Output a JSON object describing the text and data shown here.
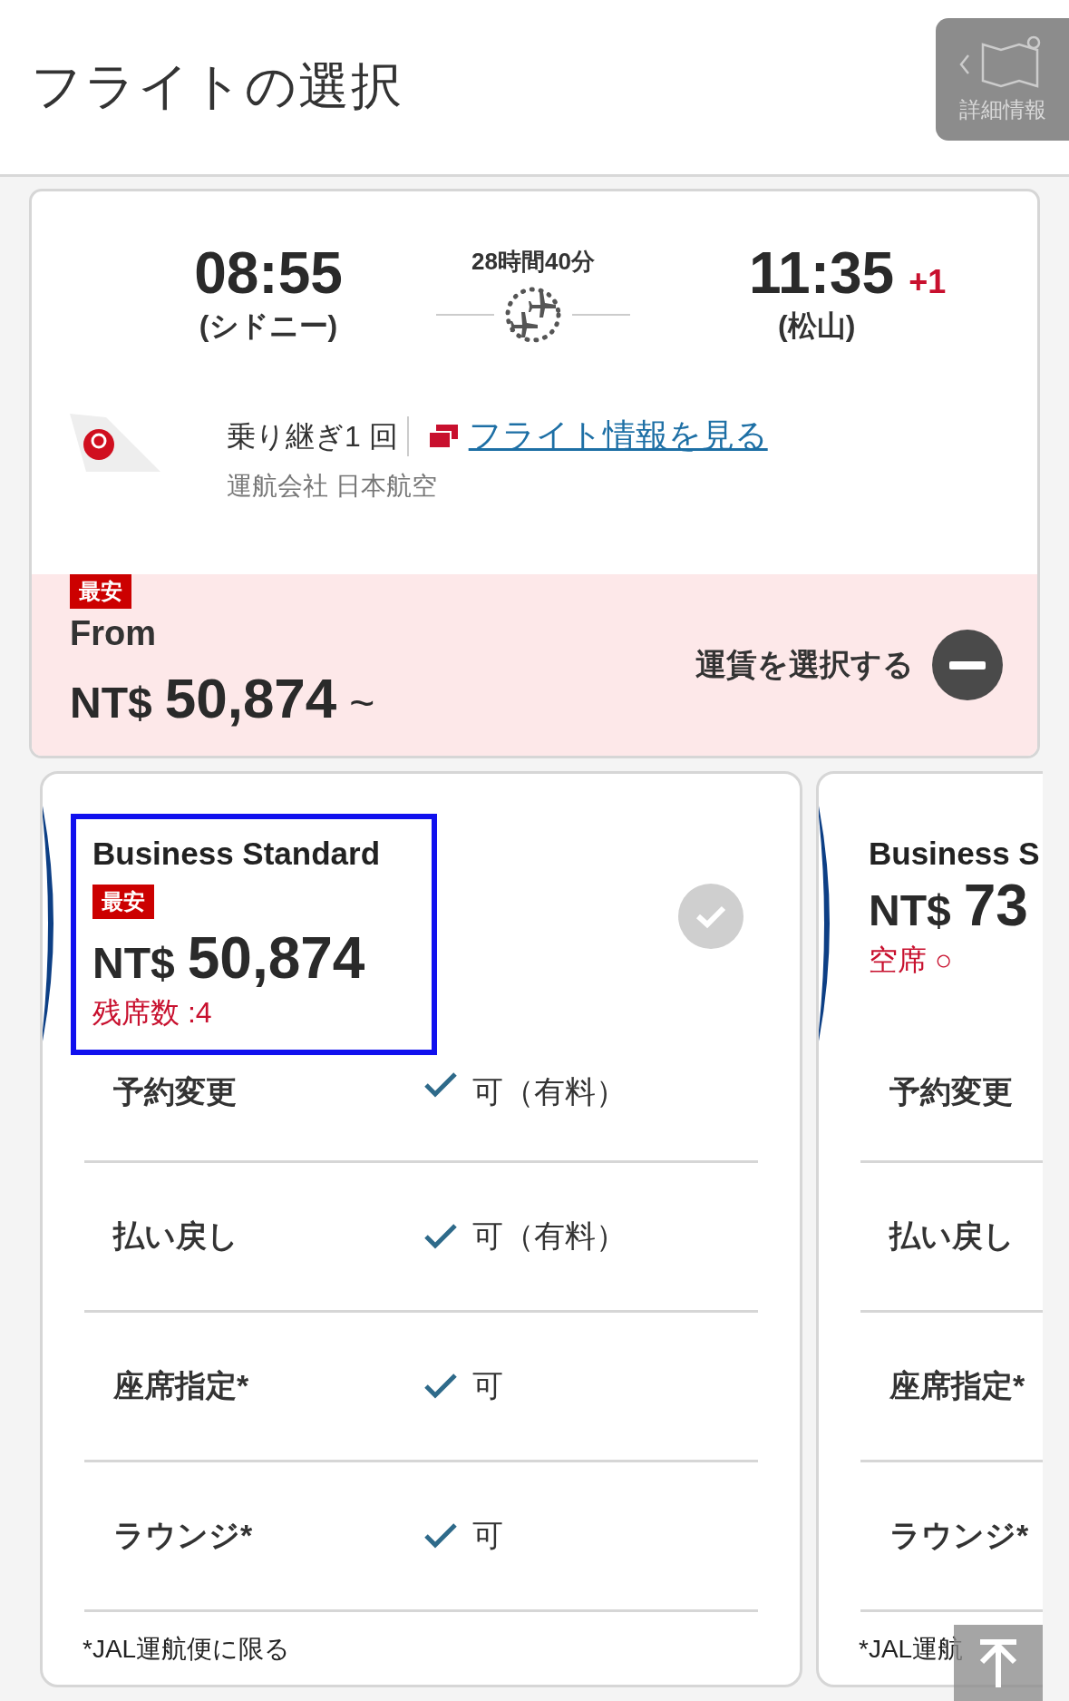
{
  "header": {
    "title": "フライトの選択",
    "detail_button": "詳細情報"
  },
  "flight": {
    "depart": {
      "time": "08:55",
      "city": "(シドニー)"
    },
    "duration": "28時間40分",
    "arrive": {
      "time": "11:35",
      "day_offset": "+1",
      "city": "(松山)"
    },
    "connections": "乗り継ぎ1 回",
    "flight_info_link": "フライト情報を見る",
    "operator": "運航会社 日本航空",
    "price_panel": {
      "badge": "最安",
      "from_label": "From",
      "currency": "NT$",
      "amount": "50,874",
      "suffix": "~",
      "select_label": "運賃を選択する",
      "expanded": true
    }
  },
  "fares": [
    {
      "name": "Business Standard",
      "badge": "最安",
      "currency": "NT$",
      "amount": "50,874",
      "availability": "残席数 :4",
      "focused": true,
      "selected": false,
      "features": [
        {
          "label": "予約変更",
          "value": "可（有料）",
          "available": true
        },
        {
          "label": "払い戻し",
          "value": "可（有料）",
          "available": true
        },
        {
          "label": "座席指定*",
          "value": "可",
          "available": true
        },
        {
          "label": "ラウンジ*",
          "value": "可",
          "available": true
        }
      ],
      "note": "*JAL運航便に限る"
    },
    {
      "name": "Business S",
      "currency": "NT$",
      "amount": "73",
      "availability": "空席 ○",
      "focused": false,
      "features": [
        {
          "label": "予約変更"
        },
        {
          "label": "払い戻し"
        },
        {
          "label": "座席指定*"
        },
        {
          "label": "ラウンジ*"
        }
      ],
      "note": "*JAL運航"
    }
  ]
}
